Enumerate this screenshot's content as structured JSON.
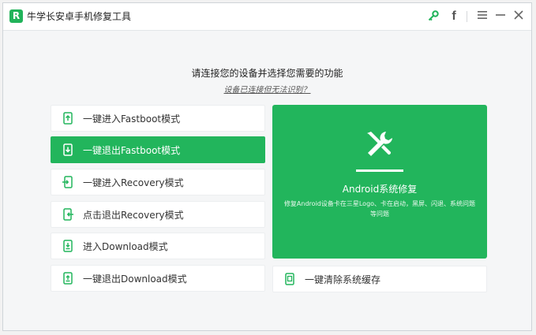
{
  "app": {
    "title": "牛学长安卓手机修复工具",
    "logo_letter": "R"
  },
  "toolbar": {
    "key_icon": "key-icon",
    "facebook_label": "f",
    "menu_icon": "menu-icon",
    "minimize_icon": "minimize-icon",
    "close_icon": "close-icon"
  },
  "main": {
    "heading": "请连接您的设备并选择您需要的功能",
    "subheading": "设备已连接但无法识别？"
  },
  "modes": [
    {
      "label": "一键进入Fastboot模式",
      "icon": "phone-arrow-up-icon",
      "active": false
    },
    {
      "label": "一键退出Fastboot模式",
      "icon": "phone-arrow-down-icon",
      "active": true
    },
    {
      "label": "一键进入Recovery模式",
      "icon": "phone-enter-icon",
      "active": false
    },
    {
      "label": "点击退出Recovery模式",
      "icon": "phone-exit-icon",
      "active": false
    },
    {
      "label": "进入Download模式",
      "icon": "phone-download-icon",
      "active": false
    },
    {
      "label": "一键退出Download模式",
      "icon": "phone-exit-download-icon",
      "active": false
    }
  ],
  "repair": {
    "title": "Android系统修复",
    "description": "修复Android设备卡在三星Logo、卡在启动，黑屏、闪退、系统问题等问题",
    "icon": "wrench-screwdriver-icon"
  },
  "clear_cache": {
    "label": "一键清除系统缓存",
    "icon": "phone-clean-icon"
  },
  "colors": {
    "accent": "#22b55c",
    "background": "#f5f6f7"
  }
}
